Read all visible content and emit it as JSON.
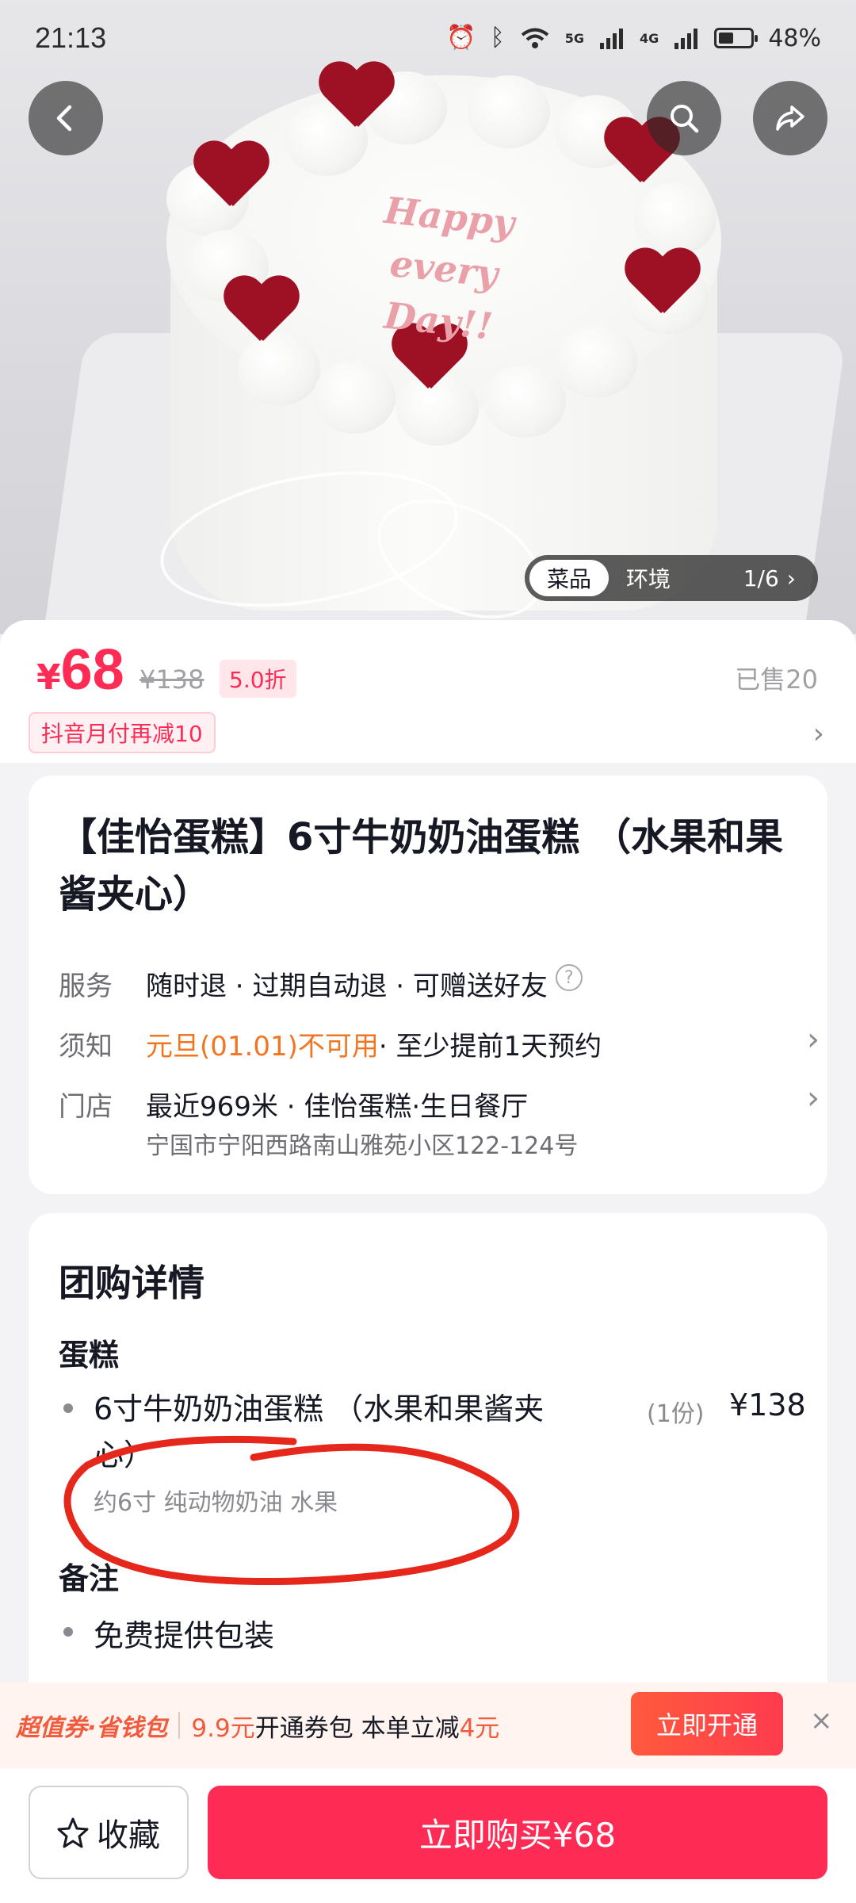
{
  "status_bar": {
    "time": "21:13",
    "network_5g": "5G",
    "network_4g": "4G",
    "battery": "48%",
    "battery_level": 0.48
  },
  "hero": {
    "cake_text_line1": "Happy",
    "cake_text_line2": "every",
    "cake_text_line3": "Day!!",
    "gallery_tabs": [
      "菜品",
      "环境"
    ],
    "gallery_counter": "1/6",
    "gallery_chevron": "›"
  },
  "price": {
    "currency": "¥",
    "current": "68",
    "original": "¥138",
    "discount": "5.0折",
    "sold": "已售20",
    "promo": "抖音月付再减10"
  },
  "product": {
    "title": "【佳怡蛋糕】6寸牛奶奶油蛋糕 （水果和果酱夹心）",
    "service_label": "服务",
    "service_text": "随时退 · 过期自动退 · 可赠送好友",
    "notice_label": "须知",
    "notice_warn": "元旦(01.01)不可用",
    "notice_text": " · 至少提前1天预约",
    "store_label": "门店",
    "store_text": "最近969米 · 佳怡蛋糕·生日餐厅",
    "store_address": "宁国市宁阳西路南山雅苑小区122-124号"
  },
  "details": {
    "title": "团购详情",
    "category": "蛋糕",
    "item_name": "6寸牛奶奶油蛋糕 （水果和果酱夹心）",
    "item_qty": "(1份)",
    "item_price": "¥138",
    "item_desc": "约6寸 纯动物奶油 水果",
    "notes_title": "备注",
    "note_item": "免费提供包装"
  },
  "coupon_bar": {
    "brand": "超值券·省钱包",
    "price_text": "9.9元",
    "text1": "开通券包 本单立减",
    "amount": "4元",
    "button": "立即开通",
    "close": "×"
  },
  "bottom_bar": {
    "favorite": "收藏",
    "buy": "立即购买¥68"
  },
  "colors": {
    "accent": "#fe2c55",
    "warning": "#f27621",
    "annotation": "#e5271c"
  }
}
